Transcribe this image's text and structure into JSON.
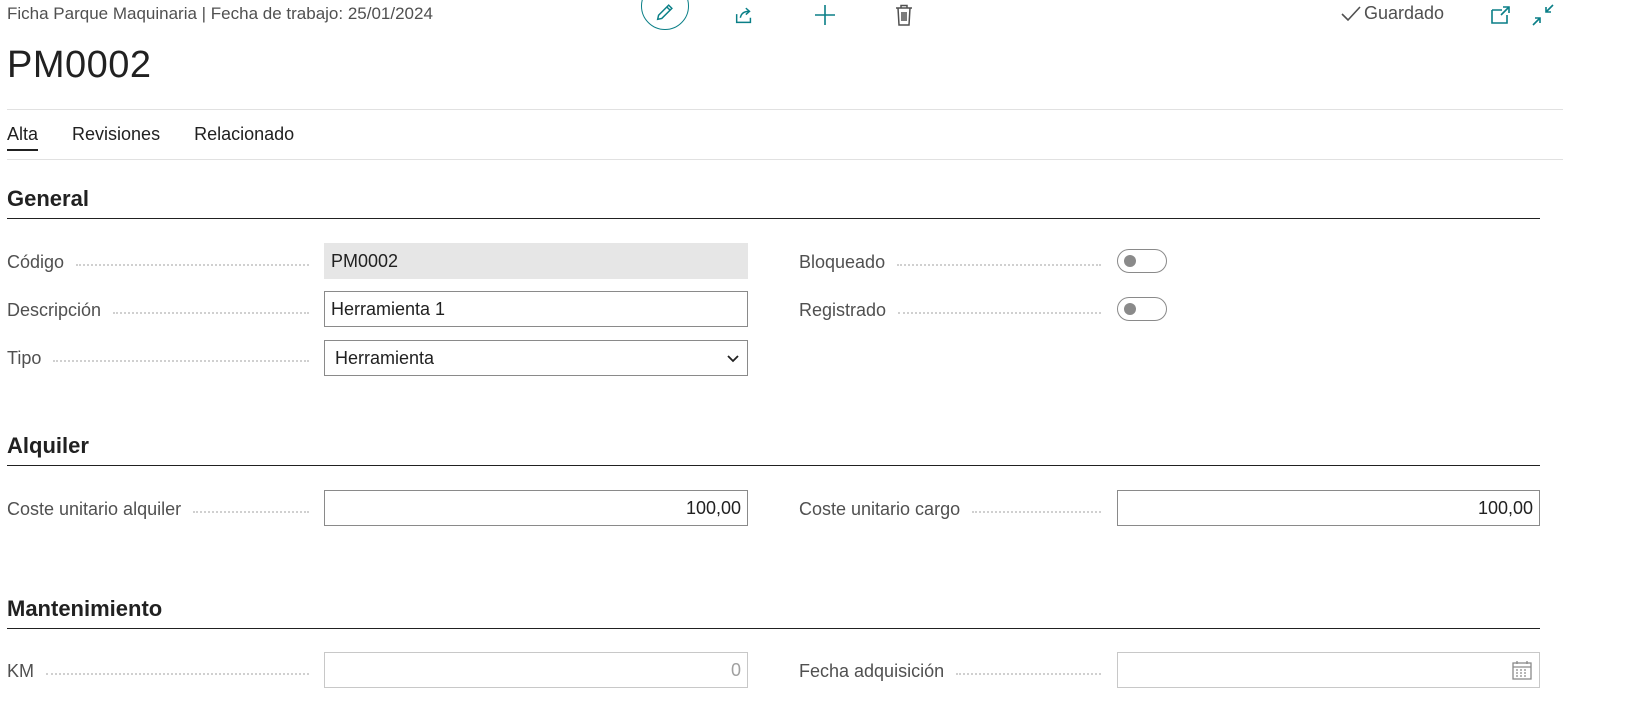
{
  "header": {
    "caption": "Ficha Parque Maquinaria | Fecha de trabajo: 25/01/2024",
    "title": "PM0002",
    "saved_label": "Guardado"
  },
  "tabs": [
    {
      "label": "Alta",
      "active": true
    },
    {
      "label": "Revisiones",
      "active": false
    },
    {
      "label": "Relacionado",
      "active": false
    }
  ],
  "sections": {
    "general": {
      "title": "General",
      "codigo_label": "Código",
      "codigo_value": "PM0002",
      "descripcion_label": "Descripción",
      "descripcion_value": "Herramienta 1",
      "tipo_label": "Tipo",
      "tipo_value": "Herramienta",
      "bloqueado_label": "Bloqueado",
      "bloqueado_on": false,
      "registrado_label": "Registrado",
      "registrado_on": false
    },
    "alquiler": {
      "title": "Alquiler",
      "coste_alquiler_label": "Coste unitario alquiler",
      "coste_alquiler_value": "100,00",
      "coste_cargo_label": "Coste unitario cargo",
      "coste_cargo_value": "100,00"
    },
    "mantenimiento": {
      "title": "Mantenimiento",
      "km_label": "KM",
      "km_value": "0",
      "fecha_label": "Fecha adquisición",
      "fecha_value": ""
    }
  },
  "icons": {
    "edit": "pencil-icon",
    "share": "share-icon",
    "new": "plus-icon",
    "delete": "trash-icon",
    "saved": "check-icon",
    "open_new_window": "open-new-window-icon",
    "collapse": "collapse-icon",
    "dropdown": "chevron-down-icon",
    "calendar": "calendar-icon"
  },
  "colors": {
    "accent": "#0a7f87",
    "text": "#212121",
    "muted": "#505050"
  }
}
